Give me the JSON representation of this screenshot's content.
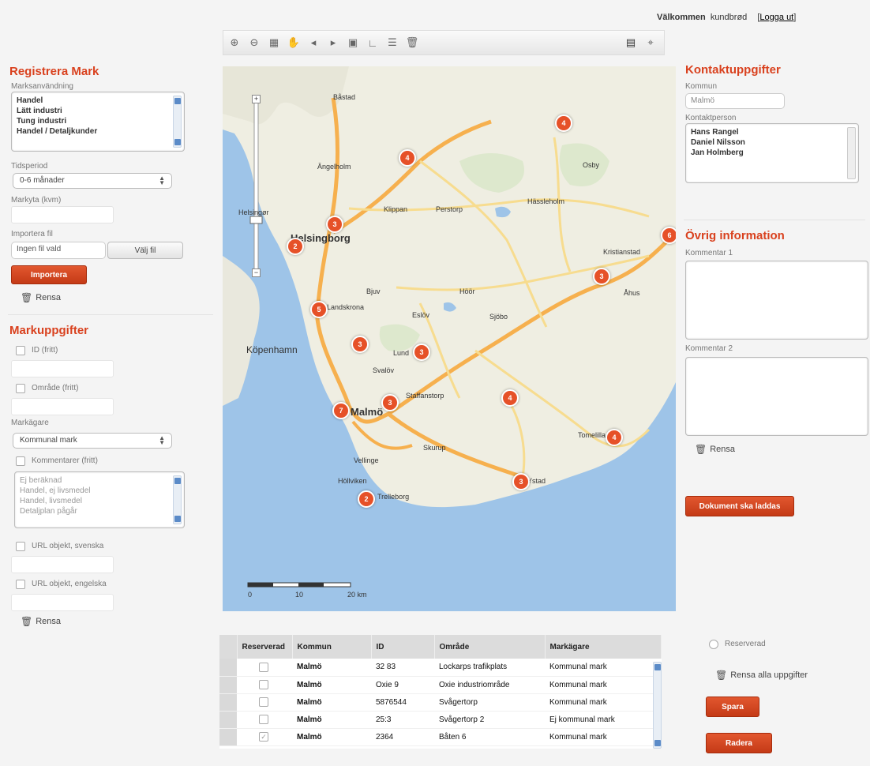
{
  "header": {
    "welcome": "Välkommen",
    "user": "kundbrød",
    "logout": "Logga ut"
  },
  "left": {
    "register_title": "Registrera Mark",
    "category_label": "Marksanvändning",
    "category_options": [
      "Handel",
      "Lätt industri",
      "Tung industri",
      "Handel / Detaljkunder"
    ],
    "period_label": "Tidsperiod",
    "period_value": "0-6 månader",
    "size_label": "Markyta (kvm)",
    "import_label": "Importera fil",
    "file_placeholder": "Ingen fil vald",
    "browse_button": "Välj fil",
    "import_button": "Importera",
    "reset_label": "Rensa",
    "details_title": "Markuppgifter",
    "id_label": "ID (fritt)",
    "area_label": "Område (fritt)",
    "owner_label": "Markägare",
    "owner_value": "Kommunal mark",
    "comments_label": "Kommentarer (fritt)",
    "comment_items": [
      "Ej beräknad",
      "Handel, ej livsmedel",
      "Handel, livsmedel",
      "Detaljplan pågår"
    ],
    "url_sv_label": "URL objekt, svenska",
    "url_en_label": "URL objekt, engelska",
    "reset2_label": "Rensa"
  },
  "toolbar": {
    "icons": [
      "zoom-in-icon",
      "zoom-out-icon",
      "zoom-extent-icon",
      "pan-hand-icon",
      "previous-extent-icon",
      "next-extent-icon",
      "identify-icon",
      "measure-icon",
      "legend-icon",
      "delete-icon"
    ]
  },
  "map": {
    "place_labels": [
      "Båstad",
      "Ängelholm",
      "Helsingborg",
      "Landskrona",
      "Lund",
      "Malmö",
      "Trelleborg",
      "Ystad",
      "Kristianstad",
      "Höör",
      "Hässleholm",
      "Eslöv",
      "Klippan",
      "Perstorp",
      "Sjöbo",
      "Tomelilla",
      "Åhus",
      "Bjuv",
      "Svalöv",
      "Skurup",
      "Vellinge",
      "Höllviken",
      "Osby",
      "Staffanstorp",
      "Köpenhamn",
      "Helsingør"
    ],
    "marker_numbers": [
      "4",
      "4",
      "3",
      "2",
      "5",
      "3",
      "3",
      "3",
      "7",
      "4",
      "3",
      "6",
      "4",
      "3",
      "2"
    ],
    "scale_labels": [
      "0",
      "10",
      "20 km"
    ]
  },
  "right": {
    "contact_title": "Kontaktuppgifter",
    "municipality_label": "Kommun",
    "municipality_value": "Malmö",
    "contact_person_label": "Kontaktperson",
    "contacts": [
      "Hans Rangel",
      "Daniel Nilsson",
      "Jan Holmberg"
    ],
    "other_title": "Övrig information",
    "comment1_label": "Kommentar 1",
    "comment2_label": "Kommentar 2",
    "reset_label": "Rensa",
    "submit_button": "Dokument ska laddas"
  },
  "table": {
    "headers": [
      "Reserverad",
      "Kommun",
      "ID",
      "Område",
      "Markägare"
    ],
    "rows": [
      {
        "kommun": "Malmö",
        "id": "32 83",
        "omrade": "Lockarps trafikplats",
        "markagare": "Kommunal mark"
      },
      {
        "kommun": "Malmö",
        "id": "Oxie 9",
        "omrade": "Oxie industriområde",
        "markagare": "Kommunal mark"
      },
      {
        "kommun": "Malmö",
        "id": "5876544",
        "omrade": "Svågertorp",
        "markagare": "Kommunal mark"
      },
      {
        "kommun": "Malmö",
        "id": "25:3",
        "omrade": "Svågertorp 2",
        "markagare": "Ej kommunal mark"
      },
      {
        "kommun": "Malmö",
        "id": "2364",
        "omrade": "Båten 6",
        "markagare": "Kommunal mark"
      }
    ]
  },
  "bottom_right": {
    "reserved_label": "Reserverad",
    "reset_all_label": "Rensa alla uppgifter",
    "save_button": "Spara",
    "delete_button": "Radera"
  },
  "colors": {
    "accent": "#d9411e",
    "marker": "#e65128",
    "sea": "#9ec4e8",
    "land": "#efeee2"
  }
}
